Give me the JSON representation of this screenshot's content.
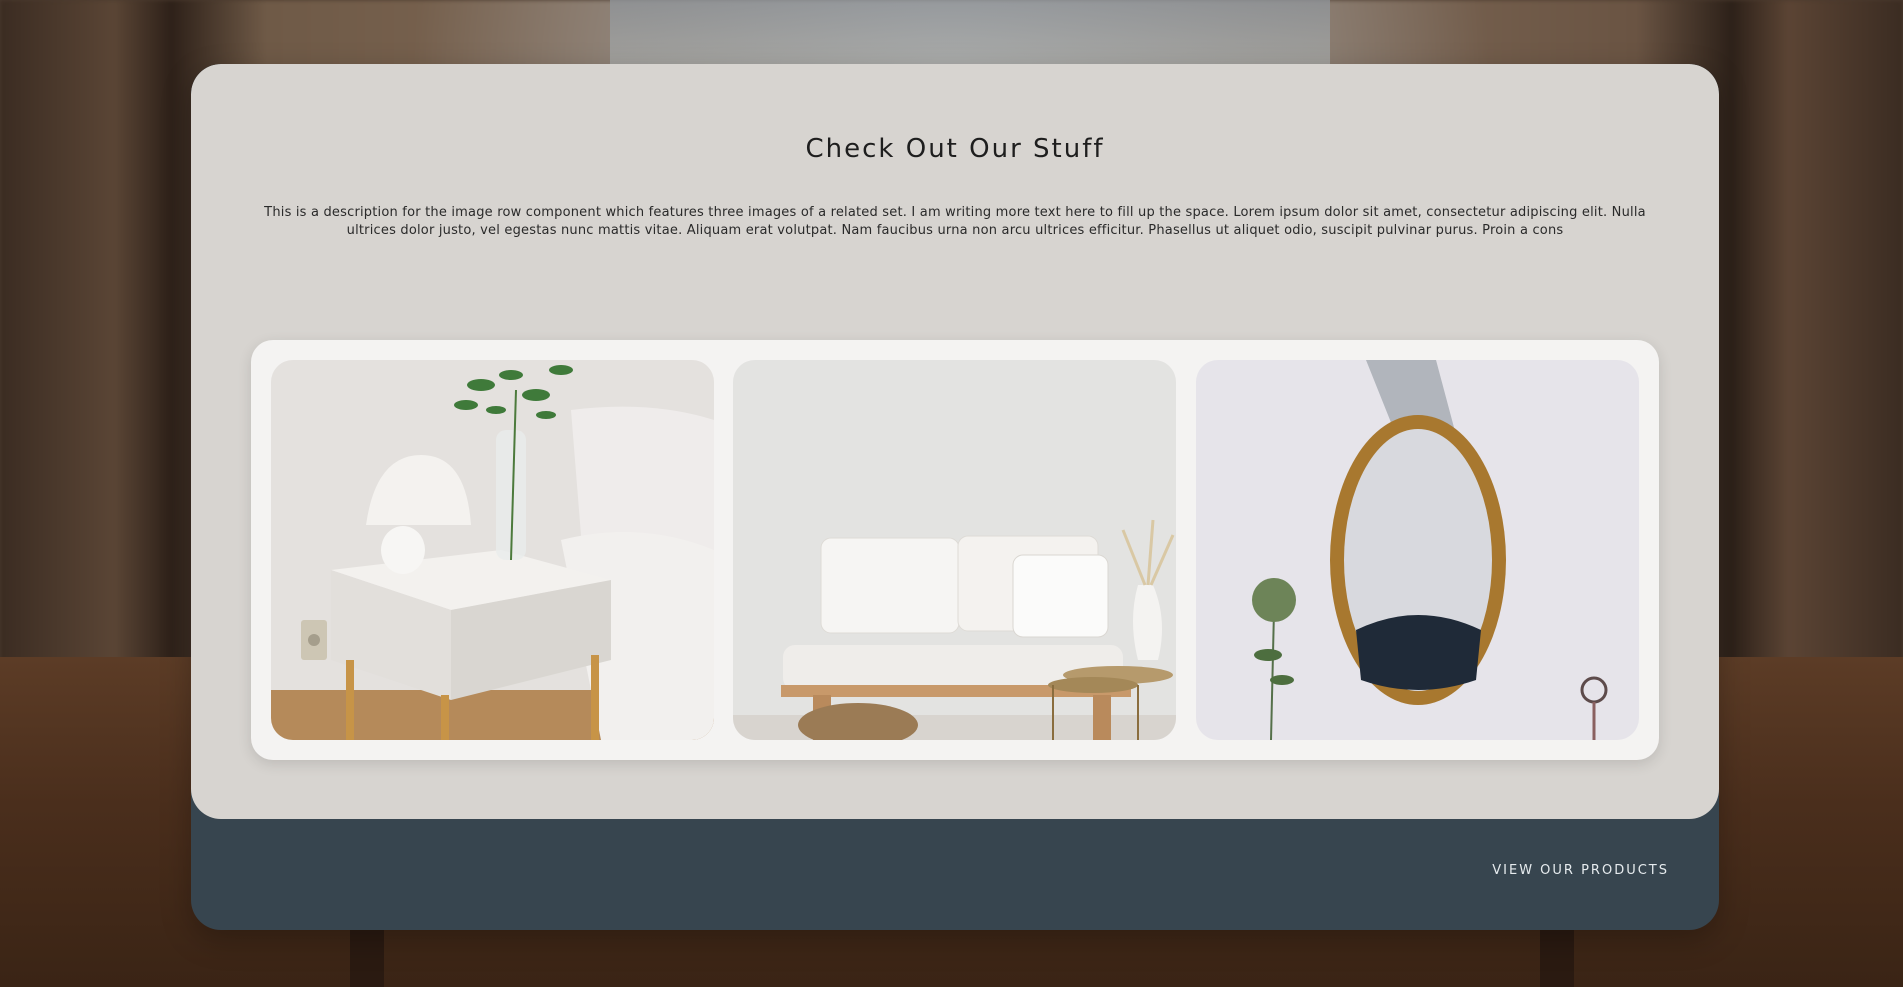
{
  "header": {
    "title": "Check Out Our Stuff",
    "description": "This is a description for the image row component which features three images of a related set. I am writing more text here to fill up the space. Lorem ipsum dolor sit amet, consectetur adipiscing elit. Nulla ultrices dolor justo, vel egestas nunc mattis vitae. Aliquam erat volutpat. Nam faucibus urna non arcu ultrices efficitur. Phasellus ut aliquet odio, suscipit pulvinar purus. Proin a cons"
  },
  "gallery": {
    "images": [
      {
        "subject": "white bedside table with lamp and plant"
      },
      {
        "subject": "white sofa with pillows and side tables"
      },
      {
        "subject": "oval gold mirror on white wall"
      }
    ]
  },
  "footer": {
    "cta_label": "VIEW OUR PRODUCTS"
  },
  "colors": {
    "panel": "#d7d4d0",
    "footer": "#37454f",
    "gallery_bg": "#f4f3f2"
  }
}
